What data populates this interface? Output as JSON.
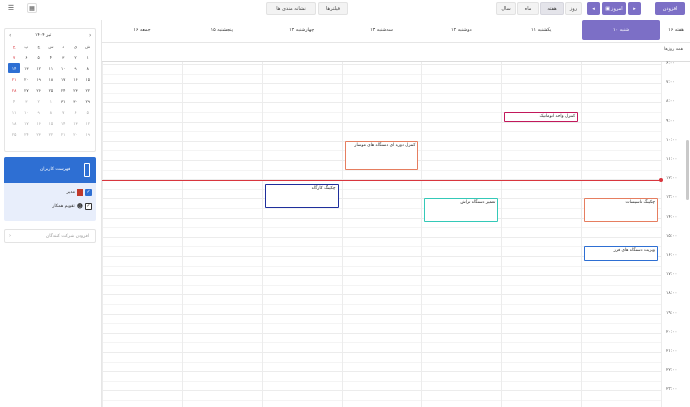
{
  "toolbar": {
    "today_label": "امروز",
    "range_label": "اقامت",
    "views": [
      "روز",
      "هفته",
      "ماه",
      "سال"
    ],
    "active_view": "هفته",
    "filters_label": "فیلترها",
    "holidays_label": "نشانه مندی ها",
    "add_label": "افزودن"
  },
  "minical": {
    "title": "۱۴۰۴ تیر",
    "weekdays": [
      "ش",
      "ی",
      "د",
      "س",
      "چ",
      "پ",
      "ج"
    ],
    "weeks": [
      [
        "۱",
        "۲",
        "۳",
        "۴",
        "۵",
        "۶",
        "۷"
      ],
      [
        "۸",
        "۹",
        "۱۰",
        "۱۱",
        "۱۲",
        "۱۳",
        "۱۴"
      ],
      [
        "۱۵",
        "۱۶",
        "۱۷",
        "۱۸",
        "۱۹",
        "۲۰",
        "۲۱"
      ],
      [
        "۲۲",
        "۲۳",
        "۲۴",
        "۲۵",
        "۲۶",
        "۲۷",
        "۲۸"
      ],
      [
        "۲۹",
        "۳۰",
        "۳۱",
        "۱",
        "۲",
        "۳",
        "۴"
      ],
      [
        "۵",
        "۶",
        "۷",
        "۸",
        "۹",
        "۱۰",
        "۱۱"
      ],
      [
        "۱۲",
        "۱۳",
        "۱۴",
        "۱۵",
        "۱۶",
        "۱۷",
        "۱۸"
      ],
      [
        "۱۹",
        "۲۰",
        "۲۱",
        "۲۲",
        "۲۳",
        "۲۴",
        "۲۵"
      ]
    ],
    "today": "۱۴"
  },
  "users": {
    "title": "فهرست کاربران",
    "items": [
      {
        "label": "مدیر",
        "color": "#c0392b"
      },
      {
        "label": "تقویم همکار",
        "color": "#333333"
      }
    ],
    "add_placeholder": "افزودن شرکت کنندگان"
  },
  "week": {
    "week_label": "هفته ۱۶",
    "days": [
      "شنبه ۱۰",
      "یکشنبه ۱۱",
      "دوشنبه ۱۲",
      "سه‌شنبه ۱۳",
      "چهارشنبه ۱۴",
      "پنجشنبه ۱۵",
      "جمعه ۱۶"
    ],
    "active_day": "شنبه ۱۰",
    "allday_label": "همه روزها",
    "times": [
      "۶:۰۰",
      "۷:۰۰",
      "۸:۰۰",
      "۹:۰۰",
      "۱۰:۰۰",
      "۱۱:۰۰",
      "۱۲:۰۰",
      "۱۳:۰۰",
      "۱۴:۰۰",
      "۱۵:۰۰",
      "۱۶:۰۰",
      "۱۷:۰۰",
      "۱۸:۰۰",
      "۱۹:۰۰",
      "۲۰:۰۰",
      "۲۱:۰۰",
      "۲۲:۰۰",
      "۲۳:۰۰"
    ]
  },
  "events": [
    {
      "title": "کنترل واحد اتوماتیک",
      "day": 1,
      "start": "۸:۳۰",
      "end": "۹:۰۰",
      "color": "#c2185b"
    },
    {
      "title": "کنترل دوره ای دستگاه های موسار",
      "day": 3,
      "start": "۱۰:۰۰",
      "end": "۱۱:۳۰",
      "color": "#e67e60"
    },
    {
      "title": "چکینگ کارگاه",
      "day": 4,
      "start": "۱۲:۱۵",
      "end": "۱۳:۳۰",
      "color": "#1f2f9c"
    },
    {
      "title": "تعمیر دستگاه تراش",
      "day": 2,
      "start": "۱۳:۰۰",
      "end": "۱۴:۱۵",
      "color": "#34c9b8"
    },
    {
      "title": "چکینگ تاسیسات",
      "day": 0,
      "start": "۱۳:۰۰",
      "end": "۱۴:۱۵",
      "color": "#e67e60"
    },
    {
      "title": "ویزیت دستگاه های فرز",
      "day": 0,
      "start": "۱۵:۳۰",
      "end": "۱۶:۱۵",
      "color": "#2e6fd3"
    }
  ],
  "now_time": "۱۲:۰۰"
}
